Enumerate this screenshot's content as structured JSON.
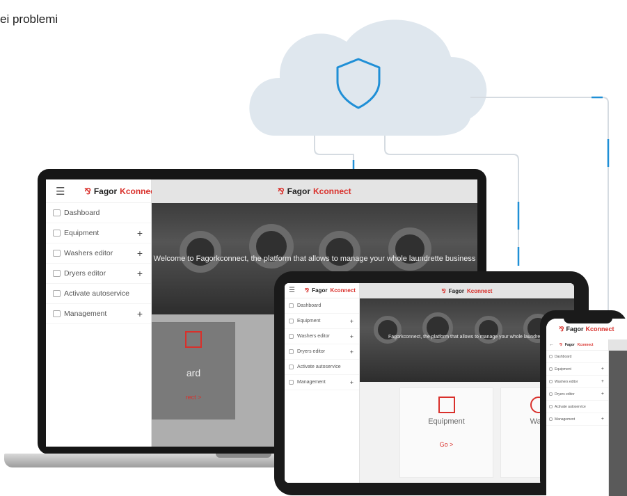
{
  "headline": "ei problemi",
  "brand": {
    "name_part1": "Fagor",
    "name_part2": "Kconnect",
    "accent": "#d9302b",
    "cloud_color": "#dfe7ee",
    "shield_color": "#1f8fd6"
  },
  "icons": {
    "menu": "hamburger-icon",
    "shield": "shield-icon",
    "dashboard": "grid-icon",
    "equipment": "box-icon",
    "washers": "washer-icon",
    "dryers": "dryer-icon",
    "autoservice": "plug-icon",
    "management": "folder-icon"
  },
  "app": {
    "menu": [
      {
        "label": "Dashboard",
        "expandable": false
      },
      {
        "label": "Equipment",
        "expandable": true
      },
      {
        "label": "Washers editor",
        "expandable": true
      },
      {
        "label": "Dryers editor",
        "expandable": true
      },
      {
        "label": "Activate autoservice",
        "expandable": false
      },
      {
        "label": "Management",
        "expandable": true
      }
    ],
    "plus_symbol": "+",
    "welcome": "Welcome to Fagorkconnect, the platform that allows to manage your whole laundrette business",
    "welcome_tablet": "Fagorkconnect, the platform that allows to manage your whole laundrette",
    "laptop_card": {
      "title": "ard",
      "link": "rect >"
    },
    "tablet_cards": [
      {
        "title": "Equipment",
        "link": "Go >"
      },
      {
        "title": "Wast",
        "link": ""
      }
    ]
  }
}
